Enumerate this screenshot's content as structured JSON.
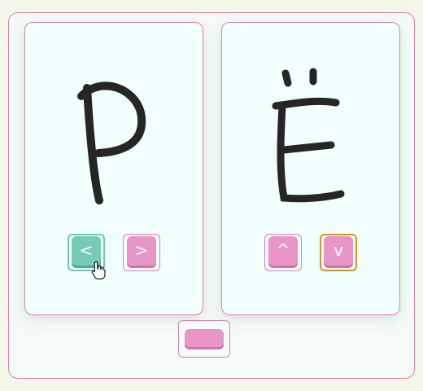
{
  "left_card": {
    "letter": "Р",
    "prev_label": "<",
    "next_label": ">"
  },
  "right_card": {
    "letter": "Ё",
    "up_label": "^",
    "down_label": "v"
  },
  "colors": {
    "accent_pink": "#e796c6",
    "accent_teal": "#75cbb5",
    "focus_orange": "#d39527",
    "border_pink": "#e07fae"
  },
  "icons": {
    "cursor": "hand-pointer-icon"
  }
}
